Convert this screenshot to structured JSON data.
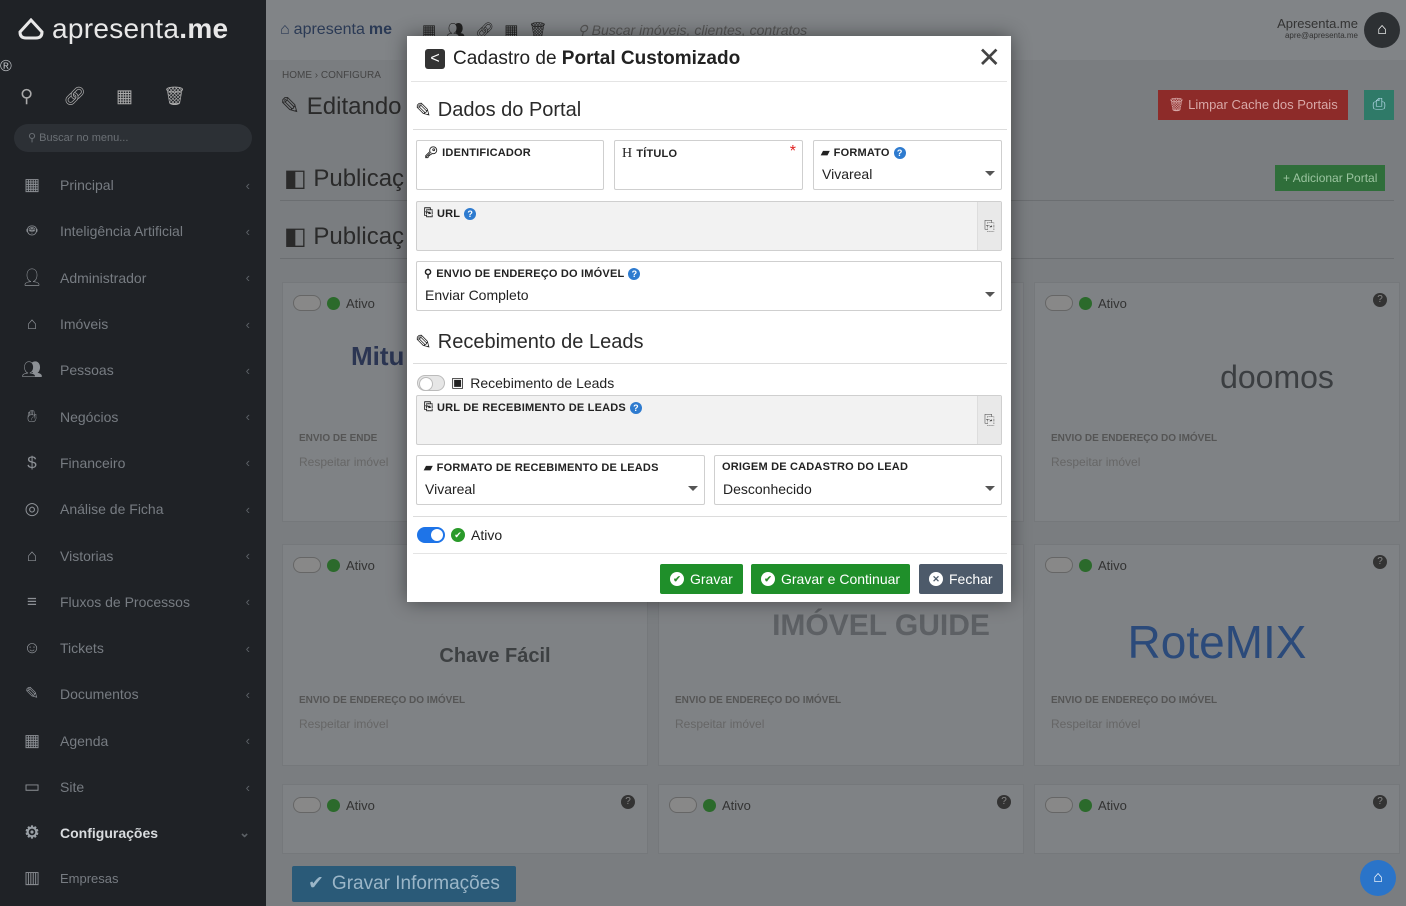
{
  "brand": {
    "name_light": "apresenta",
    "name_bold": ".me"
  },
  "sidebar": {
    "search_placeholder": "Buscar no menu...",
    "items": [
      {
        "label": "Principal",
        "icon": "dashboard-icon"
      },
      {
        "label": "Inteligência Artificial",
        "icon": "robot-icon"
      },
      {
        "label": "Administrador",
        "icon": "admin-icon"
      },
      {
        "label": "Imóveis",
        "icon": "home-icon"
      },
      {
        "label": "Pessoas",
        "icon": "people-icon"
      },
      {
        "label": "Negócios",
        "icon": "handshake-icon"
      },
      {
        "label": "Financeiro",
        "icon": "money-icon"
      },
      {
        "label": "Análise de Ficha",
        "icon": "analysis-icon"
      },
      {
        "label": "Vistorias",
        "icon": "inspection-icon"
      },
      {
        "label": "Fluxos de Processos",
        "icon": "flow-icon"
      },
      {
        "label": "Tickets",
        "icon": "ticket-icon"
      },
      {
        "label": "Documentos",
        "icon": "document-icon"
      },
      {
        "label": "Agenda",
        "icon": "calendar-icon"
      },
      {
        "label": "Site",
        "icon": "site-icon"
      },
      {
        "label": "Configurações",
        "icon": "gears-icon"
      },
      {
        "label": "Empresas",
        "icon": "building-icon"
      }
    ]
  },
  "topbar": {
    "brand_light": "apresenta",
    "brand_bold": "me",
    "search_placeholder": "Buscar imóveis, clientes, contratos",
    "user_name": "Apresenta.me",
    "user_email": "apre@apresenta.me"
  },
  "page": {
    "breadcrumb": "HOME › CONFIGURA",
    "title": "Editando",
    "clear_cache_label": "Limpar Cache dos Portais",
    "section1": "Publicaç",
    "section2": "Publicaç",
    "add_portal_label": "Adicionar Portal",
    "save_info_label": "Gravar Informações"
  },
  "cards": [
    {
      "active_label": "Ativo",
      "logo": "Mitu",
      "env_label": "ENVIO DE ENDE",
      "env_value": "Respeitar imóvel"
    },
    {
      "active_label": "Ativo",
      "logo": "doomos",
      "env_label": "ENVIO DE ENDEREÇO DO IMÓVEL",
      "env_value": "Respeitar imóvel"
    },
    {
      "active_label": "Ativo",
      "logo": "Chave Fácil",
      "env_label": "ENVIO DE ENDEREÇO DO IMÓVEL",
      "env_value": "Respeitar imóvel"
    },
    {
      "active_label": "",
      "logo": "IMÓVEL GUIDE",
      "env_label": "ENVIO DE ENDEREÇO DO IMÓVEL",
      "env_value": "Respeitar imóvel"
    },
    {
      "active_label": "Ativo",
      "logo": "RoteMIX",
      "env_label": "ENVIO DE ENDEREÇO DO IMÓVEL",
      "env_value": "Respeitar imóvel"
    },
    {
      "active_label": "Ativo"
    },
    {
      "active_label": "Ativo"
    },
    {
      "active_label": "Ativo"
    }
  ],
  "modal": {
    "title_prefix": "Cadastro de",
    "title_bold": "Portal Customizado",
    "section_portal": "Dados do Portal",
    "identificador_label": "IDENTIFICADOR",
    "identificador_value": "",
    "titulo_label": "TÍTULO",
    "titulo_value": "",
    "formato_label": "FORMATO",
    "formato_value": "Vivareal",
    "url_label": "URL",
    "url_value": "",
    "envio_label": "ENVIO DE ENDEREÇO DO IMÓVEL",
    "envio_value": "Enviar Completo",
    "section_leads": "Recebimento de Leads",
    "leads_toggle_label": "Recebimento de Leads",
    "url_leads_label": "URL DE RECEBIMENTO DE LEADS",
    "url_leads_value": "",
    "formato_leads_label": "FORMATO DE RECEBIMENTO DE LEADS",
    "formato_leads_value": "Vivareal",
    "origem_label": "ORIGEM DE CADASTRO DO LEAD",
    "origem_value": "Desconhecido",
    "ativo_label": "Ativo",
    "btn_save": "Gravar",
    "btn_save_continue": "Gravar e Continuar",
    "btn_close": "Fechar",
    "leads_enabled": false,
    "active_enabled": true
  },
  "colors": {
    "primary_green": "#1f8f2a",
    "toggle_blue": "#1e74e8",
    "required_red": "#e02020",
    "help_blue": "#2e7bcf"
  }
}
